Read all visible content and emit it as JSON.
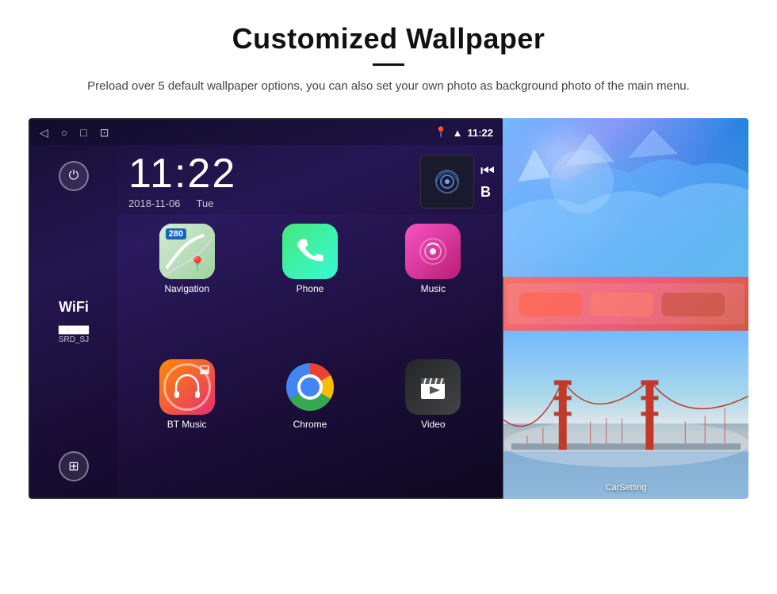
{
  "page": {
    "title": "Customized Wallpaper",
    "subtitle": "Preload over 5 default wallpaper options, you can also set your own photo as background photo of the main menu."
  },
  "screen": {
    "statusBar": {
      "time": "11:22",
      "navBack": "◁",
      "navHome": "○",
      "navRecent": "□",
      "navScreenshot": "⊡"
    },
    "clock": {
      "time": "11:22",
      "date": "2018-11-06",
      "day": "Tue"
    },
    "wifi": {
      "label": "WiFi",
      "ssid": "SRD_SJ"
    },
    "apps": [
      {
        "label": "Navigation",
        "id": "nav"
      },
      {
        "label": "Phone",
        "id": "phone"
      },
      {
        "label": "Music",
        "id": "music"
      },
      {
        "label": "BT Music",
        "id": "btmusic"
      },
      {
        "label": "Chrome",
        "id": "chrome"
      },
      {
        "label": "Video",
        "id": "video"
      }
    ]
  },
  "wallpapers": {
    "carsetting": "CarSetting"
  },
  "navigation_badge": "280"
}
